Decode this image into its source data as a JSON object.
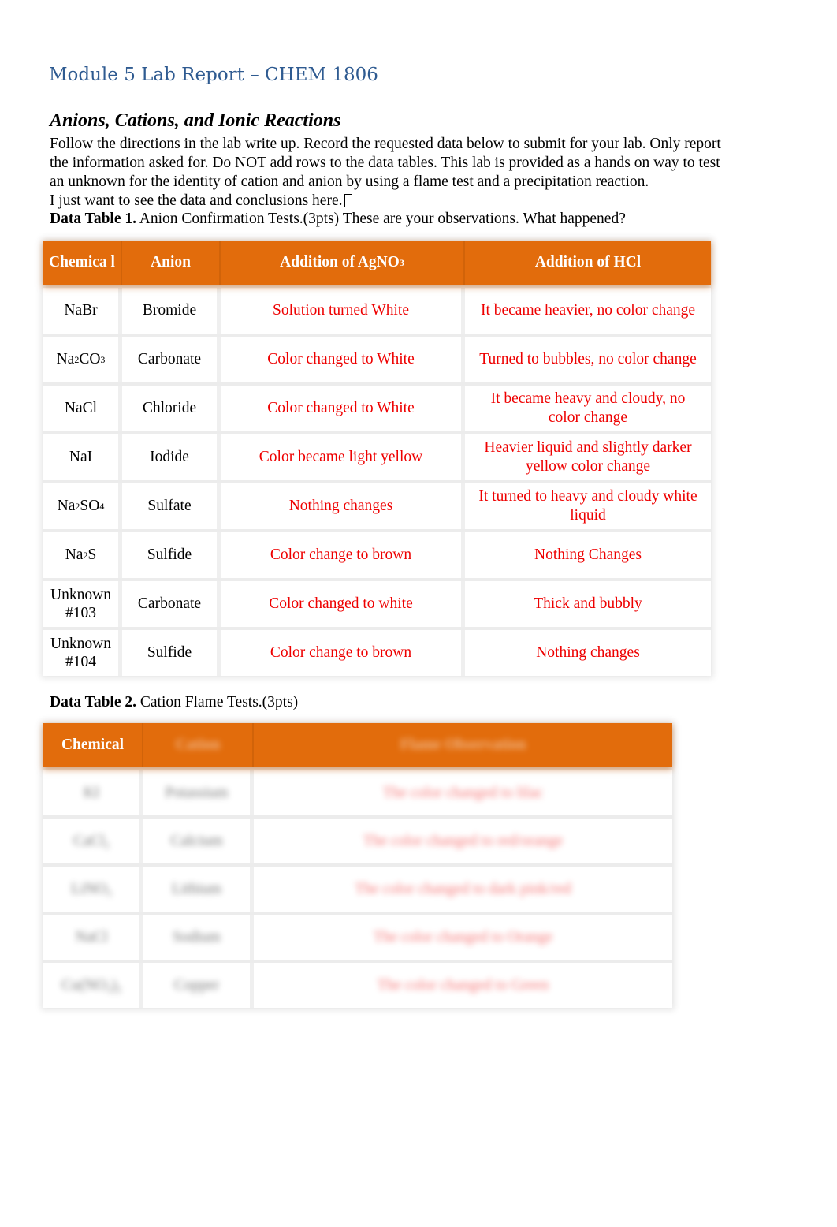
{
  "document": {
    "title": "Module 5 Lab Report – CHEM 1806",
    "subtitle": "Anions, Cations, and Ionic Reactions",
    "intro_lines": [
      "Follow the directions in the lab write up. Record the requested data below to submit for your lab. Only report",
      "the information asked for. Do NOT add rows to the data tables.  This lab is provided as a hands on way to test",
      "an unknown for the identity of cation and anion by using a flame test and a precipitation reaction.",
      "I just want to see the data and conclusions here."
    ],
    "colors": {
      "title": "#2f5b91",
      "header_bg": "#e26c0c",
      "observation_text": "#ee0000"
    }
  },
  "table1": {
    "caption_bold": "Data Table 1.",
    "caption_rest": " Anion Confirmation Tests.(3pts) These are your observations. What happened?",
    "headers": {
      "chemical": "Chemica l",
      "anion": "Anion",
      "agno3_prefix": "Addition of AgNO",
      "agno3_sub": "3",
      "hcl": "Addition of HCl"
    },
    "rows": [
      {
        "chem": "NaBr",
        "chem_parts": [],
        "anion": "Bromide",
        "agno3": "Solution turned White",
        "hcl": "It became heavier, no color change"
      },
      {
        "chem": "Na2CO3",
        "anion": "Carbonate",
        "agno3": "Color changed to White",
        "hcl": "Turned to bubbles, no color change"
      },
      {
        "chem": "NaCl",
        "anion": "Chloride",
        "agno3": "Color changed to White",
        "hcl": "It became heavy and cloudy, no color change"
      },
      {
        "chem": "NaI",
        "anion": "Iodide",
        "agno3": "Color became light yellow",
        "hcl": "Heavier liquid and slightly darker yellow color change"
      },
      {
        "chem": "Na2SO4",
        "anion": "Sulfate",
        "agno3": "Nothing changes",
        "hcl": "It turned to heavy and cloudy white liquid"
      },
      {
        "chem": "Na2S",
        "anion": "Sulfide",
        "agno3": "Color change to brown",
        "hcl": "Nothing Changes"
      },
      {
        "chem": "Unknown #103",
        "anion": "Carbonate",
        "agno3": "Color changed to white",
        "hcl": "Thick and bubbly"
      },
      {
        "chem": "Unknown #104",
        "anion": "Sulfide",
        "agno3": "Color change to brown",
        "hcl": "Nothing changes"
      }
    ]
  },
  "table2": {
    "caption_bold": "Data Table 2.",
    "caption_rest": " Cation Flame Tests.(3pts)",
    "headers": {
      "chemical": "Chemical",
      "cation": "Cation",
      "observation": "Flame Observation"
    },
    "blurred": true,
    "rows": [
      {
        "chem": "KI",
        "cation": "Potassium",
        "obs": "The color changed to lilac"
      },
      {
        "chem": "CaCl2",
        "cation": "Calcium",
        "obs": "The color changed to red/orange"
      },
      {
        "chem": "LiNO3",
        "cation": "Lithium",
        "obs": "The color changed to dark pink/red"
      },
      {
        "chem": "NaCl",
        "cation": "Sodium",
        "obs": "The color changed to Orange"
      },
      {
        "chem": "Cu(NO3)2",
        "cation": "Copper",
        "obs": "The color changed to Green"
      }
    ]
  }
}
